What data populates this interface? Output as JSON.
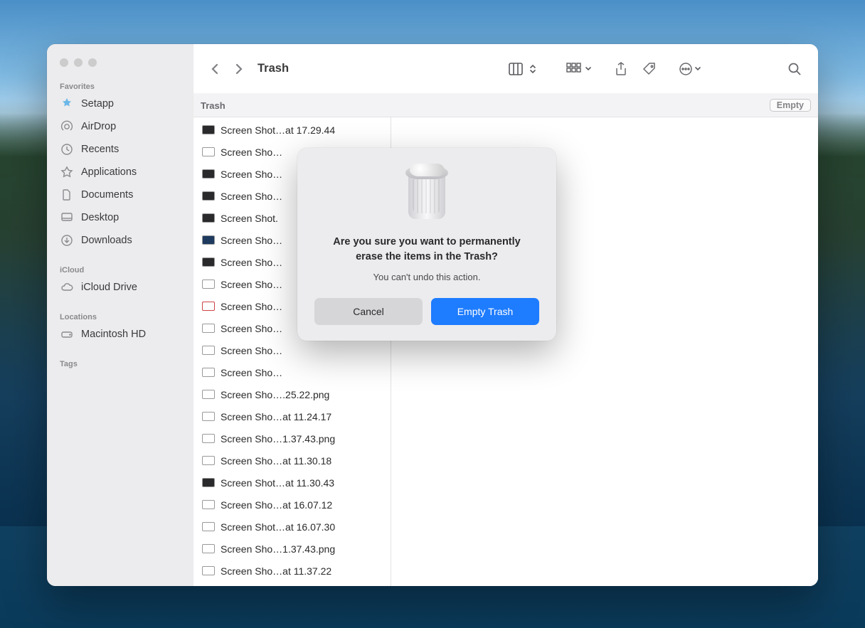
{
  "window": {
    "title": "Trash",
    "location_label": "Trash",
    "empty_button": "Empty"
  },
  "sidebar": {
    "sections": {
      "favorites": "Favorites",
      "icloud": "iCloud",
      "locations": "Locations",
      "tags": "Tags"
    },
    "items": {
      "setapp": "Setapp",
      "airdrop": "AirDrop",
      "recents": "Recents",
      "applications": "Applications",
      "documents": "Documents",
      "desktop": "Desktop",
      "downloads": "Downloads",
      "icloud_drive": "iCloud Drive",
      "macintosh_hd": "Macintosh HD"
    }
  },
  "files": [
    "Screen Shot…at 17.29.44",
    "Screen Sho…",
    "Screen Sho…",
    "Screen Sho…",
    "Screen Shot.",
    "Screen Sho…",
    "Screen Sho…",
    "Screen Sho…",
    "Screen Sho…",
    "Screen Sho…",
    "Screen Sho…",
    "Screen Sho…",
    "Screen Sho….25.22.png",
    "Screen Sho…at 11.24.17",
    "Screen Sho…1.37.43.png",
    "Screen Sho…at 11.30.18",
    "Screen Shot…at 11.30.43",
    "Screen Sho…at 16.07.12",
    "Screen Shot…at 16.07.30",
    "Screen Sho…1.37.43.png",
    "Screen Sho…at 11.37.22"
  ],
  "file_icon_styles": [
    "dark",
    "",
    "dark",
    "dark",
    "dark",
    "blue",
    "dark",
    "",
    "red",
    "",
    "",
    "",
    "",
    "",
    "",
    "",
    "dark",
    "",
    "",
    "",
    ""
  ],
  "dialog": {
    "title": "Are you sure you want to permanently erase the items in the Trash?",
    "subtitle": "You can't undo this action.",
    "cancel": "Cancel",
    "confirm": "Empty Trash"
  }
}
